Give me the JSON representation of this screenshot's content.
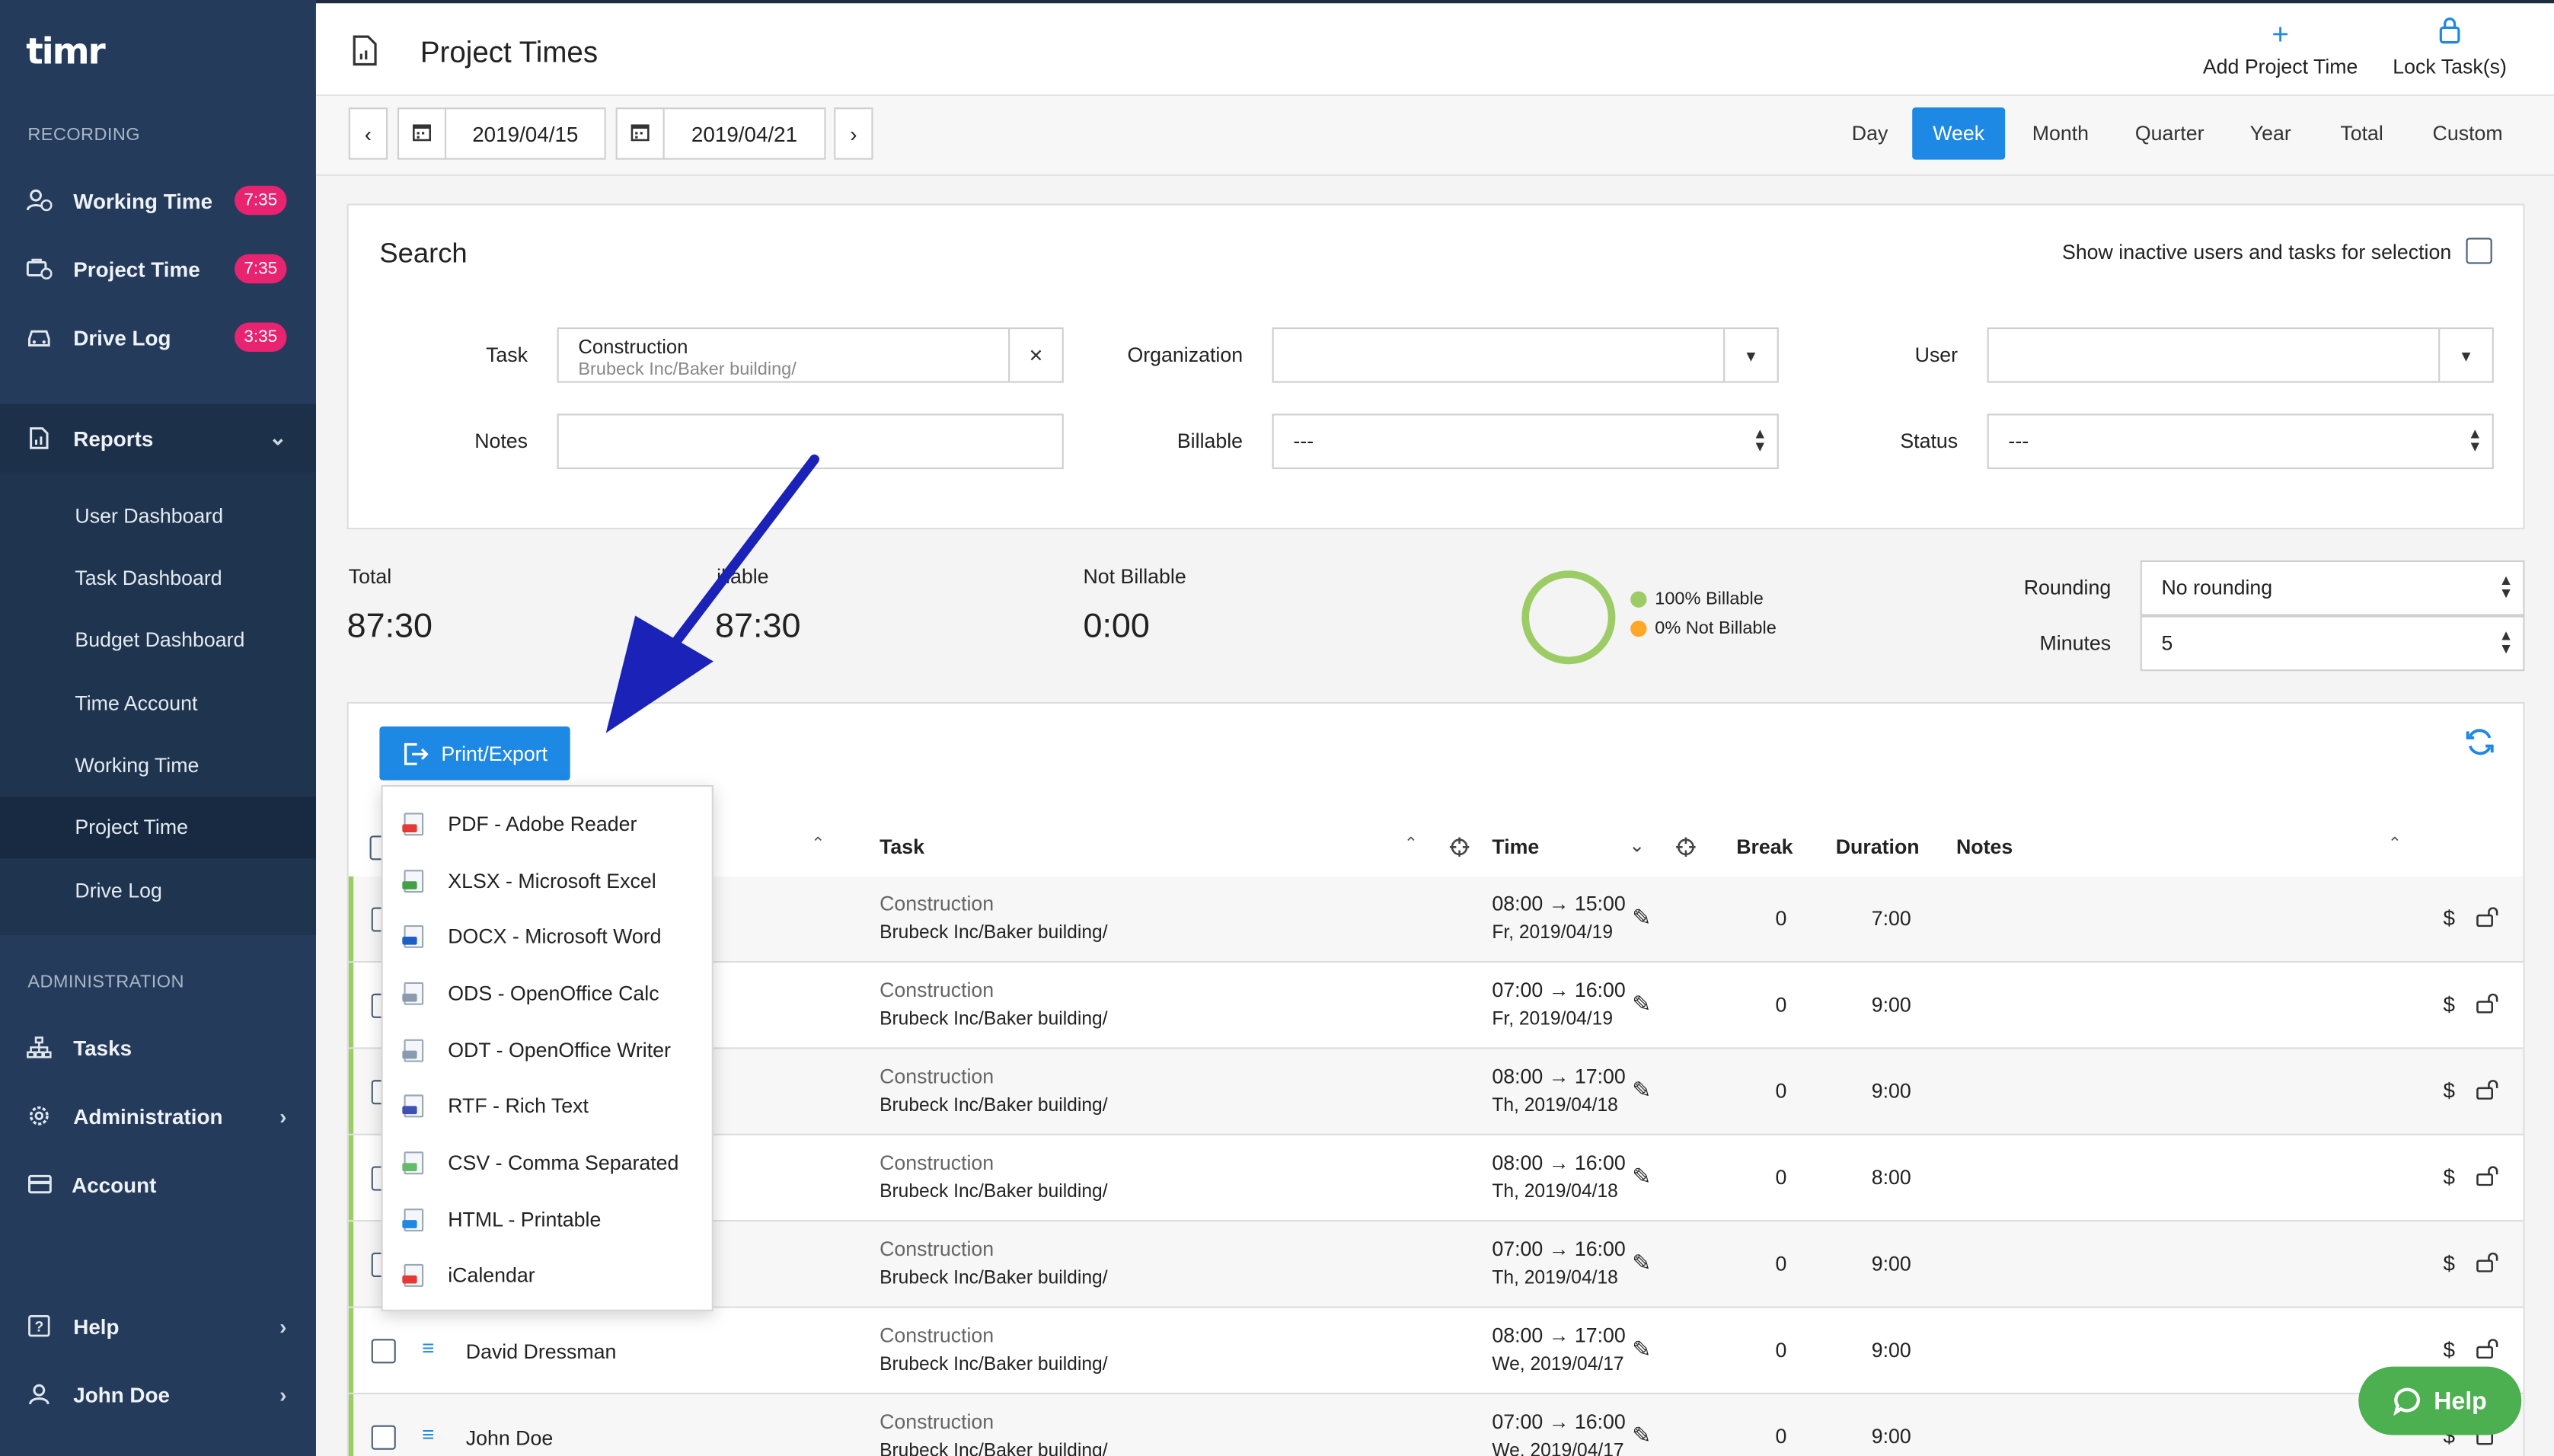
{
  "app": {
    "logo": "timr"
  },
  "sidebar": {
    "recording_label": "RECORDING",
    "recording_items": [
      {
        "label": "Working Time",
        "badge": "7:35",
        "icon": "user-clock-icon"
      },
      {
        "label": "Project Time",
        "badge": "7:35",
        "icon": "briefcase-clock-icon"
      },
      {
        "label": "Drive Log",
        "badge": "3:35",
        "icon": "car-icon"
      }
    ],
    "reports": {
      "label": "Reports",
      "icon": "report-doc-icon"
    },
    "report_items": [
      "User Dashboard",
      "Task Dashboard",
      "Budget Dashboard",
      "Time Account",
      "Working Time",
      "Project Time",
      "Drive Log"
    ],
    "admin_label": "ADMINISTRATION",
    "admin_items": [
      {
        "label": "Tasks",
        "icon": "hierarchy-icon",
        "chevron": false
      },
      {
        "label": "Administration",
        "icon": "gear-icon",
        "chevron": true
      },
      {
        "label": "Account",
        "icon": "credit-card-icon",
        "chevron": false
      }
    ],
    "footer_items": [
      {
        "label": "Help",
        "icon": "help-icon"
      },
      {
        "label": "John Doe",
        "icon": "user-icon"
      }
    ]
  },
  "header": {
    "title": "Project Times",
    "add_project_time": "Add Project Time",
    "lock_tasks": "Lock Task(s)"
  },
  "datebar": {
    "from": "2019/04/15",
    "to": "2019/04/21",
    "periods": [
      "Day",
      "Week",
      "Month",
      "Quarter",
      "Year",
      "Total",
      "Custom"
    ],
    "active_period": "Week"
  },
  "search": {
    "title": "Search",
    "show_inactive": "Show inactive users and tasks for selection",
    "task_label": "Task",
    "task_value": "Construction",
    "task_path": "Brubeck Inc/Baker building/",
    "organization_label": "Organization",
    "user_label": "User",
    "notes_label": "Notes",
    "billable_label": "Billable",
    "billable_value": "---",
    "status_label": "Status",
    "status_value": "---"
  },
  "summary": {
    "total_label": "Total",
    "total_value": "87:30",
    "billable_label": "illable",
    "billable_value": "87:30",
    "not_billable_label": "Not Billable",
    "not_billable_value": "0:00",
    "legend_billable": "100% Billable",
    "legend_not_billable": "0% Not Billable",
    "billable_fraction": 1.0,
    "rounding_label": "Rounding",
    "rounding_value": "No rounding",
    "minutes_label": "Minutes",
    "minutes_value": "5"
  },
  "colors": {
    "accent": "#1e88e5",
    "billable": "#9ccc65",
    "not_billable": "#ffa726",
    "badge": "#e8236f",
    "sidebar": "#243b5b"
  },
  "export": {
    "button": "Print/Export",
    "items": [
      {
        "label": "PDF - Adobe Reader",
        "color": "#e53935"
      },
      {
        "label": "XLSX - Microsoft Excel",
        "color": "#43a047"
      },
      {
        "label": "DOCX - Microsoft Word",
        "color": "#1e5fc7"
      },
      {
        "label": "ODS - OpenOffice Calc",
        "color": "#8a9bb0"
      },
      {
        "label": "ODT - OpenOffice Writer",
        "color": "#8a9bb0"
      },
      {
        "label": "RTF - Rich Text",
        "color": "#3f51b5"
      },
      {
        "label": "CSV - Comma Separated",
        "color": "#66bb6a"
      },
      {
        "label": "HTML - Printable",
        "color": "#1e88e5"
      },
      {
        "label": "iCalendar",
        "color": "#e53935"
      }
    ]
  },
  "table": {
    "headers": {
      "task": "Task",
      "time": "Time",
      "break": "Break",
      "duration": "Duration",
      "notes": "Notes"
    },
    "rows": [
      {
        "user": "",
        "task": "Construction",
        "path": "Brubeck Inc/Baker building/",
        "range": "08:00 → 15:00",
        "date": "Fr, 2019/04/19",
        "break": "0",
        "duration": "7:00"
      },
      {
        "user": "",
        "task": "Construction",
        "path": "Brubeck Inc/Baker building/",
        "range": "07:00 → 16:00",
        "date": "Fr, 2019/04/19",
        "break": "0",
        "duration": "9:00"
      },
      {
        "user": "",
        "task": "Construction",
        "path": "Brubeck Inc/Baker building/",
        "range": "08:00 → 17:00",
        "date": "Th, 2019/04/18",
        "break": "0",
        "duration": "9:00"
      },
      {
        "user": "",
        "task": "Construction",
        "path": "Brubeck Inc/Baker building/",
        "range": "08:00 → 16:00",
        "date": "Th, 2019/04/18",
        "break": "0",
        "duration": "8:00"
      },
      {
        "user": "",
        "task": "Construction",
        "path": "Brubeck Inc/Baker building/",
        "range": "07:00 → 16:00",
        "date": "Th, 2019/04/18",
        "break": "0",
        "duration": "9:00"
      },
      {
        "user": "David Dressman",
        "task": "Construction",
        "path": "Brubeck Inc/Baker building/",
        "range": "08:00 → 17:00",
        "date": "We, 2019/04/17",
        "break": "0",
        "duration": "9:00"
      },
      {
        "user": "John Doe",
        "task": "Construction",
        "path": "Brubeck Inc/Baker building/",
        "range": "07:00 → 16:00",
        "date": "We, 2019/04/17",
        "break": "0",
        "duration": "9:00"
      }
    ]
  },
  "help_button": "Help"
}
